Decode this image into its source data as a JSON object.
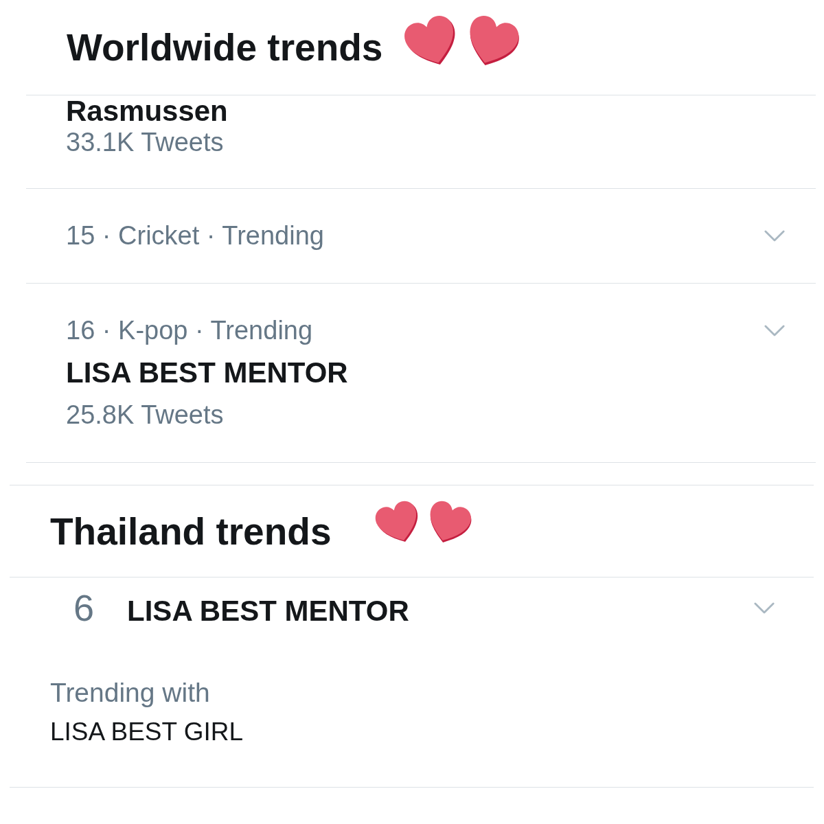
{
  "panels": [
    {
      "title": "Worldwide trends",
      "trends": [
        {
          "kind": "continued",
          "name": "Rasmussen",
          "count": "33.1K Tweets"
        },
        {
          "kind": "trend",
          "context": "15 · Cricket · Trending"
        },
        {
          "kind": "trend",
          "context": "16 · K-pop · Trending",
          "name": "LISA BEST MENTOR",
          "count": "25.8K Tweets"
        }
      ]
    },
    {
      "title": "Thailand trends",
      "trends": [
        {
          "kind": "ranked",
          "rank": "6",
          "name": "LISA BEST MENTOR",
          "related_label": "Trending with",
          "related": "LISA BEST GIRL"
        }
      ]
    }
  ]
}
